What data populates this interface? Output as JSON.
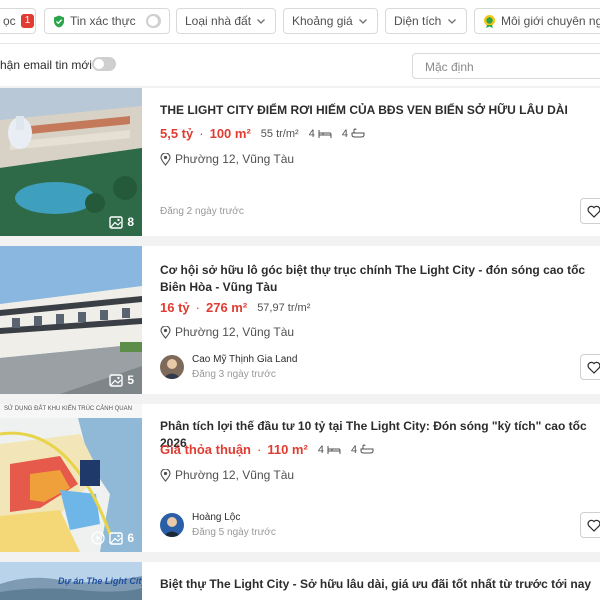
{
  "filters": {
    "first_chip_label": "ọc",
    "first_chip_badge": "1",
    "verified_label": "Tin xác thực",
    "property_type_label": "Loại nhà đất",
    "price_range_label": "Khoảng giá",
    "area_label": "Diện tích",
    "broker_label": "Môi giới chuyên nghi"
  },
  "email_row": {
    "label": "hận email tin mới",
    "sort_label": "Mặc định"
  },
  "listings": [
    {
      "title": "THE LIGHT CITY ĐIỂM RƠI HIẾM CỦA BĐS VEN BIỂN SỞ HỮU LÂU DÀI",
      "price": "5,5 tỷ",
      "area": "100 m²",
      "price_per_m2": "55 tr/m²",
      "bedrooms": "4",
      "bathrooms": "4",
      "location": "Phường 12, Vũng Tàu",
      "posted": "Đăng 2 ngày trước",
      "photo_count": "8"
    },
    {
      "title": "Cơ hội sở hữu lô góc biệt thự trục chính The Light City - đón sóng cao tốc Biên Hòa - Vũng Tàu",
      "price": "16 tỷ",
      "area": "276 m²",
      "price_per_m2": "57,97 tr/m²",
      "location": "Phường 12, Vũng Tàu",
      "agent_name": "Cao Mỹ Thịnh Gia Land",
      "posted": "Đăng 3 ngày trước",
      "photo_count": "5"
    },
    {
      "title": "Phân tích lợi thế đầu tư 10 tỷ tại The Light City: Đón sóng \"kỳ tích\" cao tốc 2026",
      "price": "Giá thỏa thuận",
      "area": "110 m²",
      "bedrooms": "4",
      "bathrooms": "4",
      "location": "Phường 12, Vũng Tàu",
      "agent_name": "Hoàng Lộc",
      "posted": "Đăng 5 ngày trước",
      "photo_count": "6",
      "thumb_caption": "SỬ DỤNG ĐẤT KHU KIẾN TRÚC CẢNH QUAN"
    },
    {
      "title": "Biệt thự The Light City - Sở hữu lâu dài, giá ưu đãi tốt nhất từ trước tới nay",
      "thumb_caption": "Dự án The Light City"
    }
  ],
  "colors": {
    "accent_red": "#e03c31",
    "verified_green": "#2aa54a"
  }
}
